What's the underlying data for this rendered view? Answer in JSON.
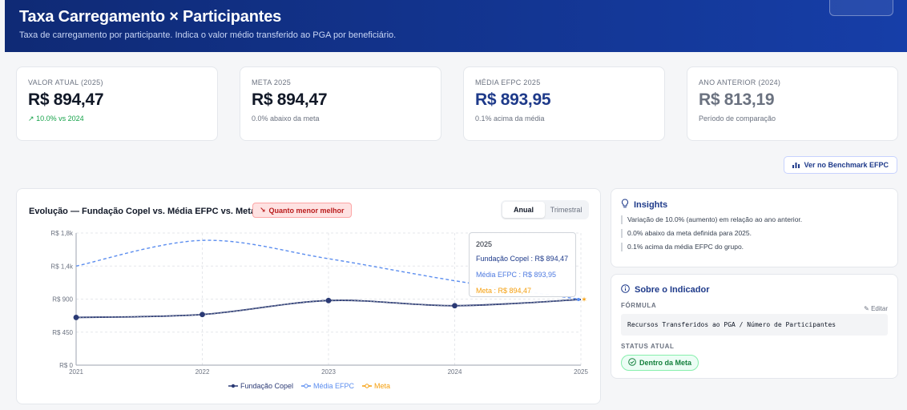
{
  "header": {
    "title": "Taxa Carregamento × Participantes",
    "subtitle": "Taxa de carregamento por participante. Indica o valor médio transferido ao PGA por beneficiário."
  },
  "kpis": [
    {
      "label": "VALOR ATUAL (2025)",
      "value": "R$ 894,47",
      "sub": "10.0% vs 2024",
      "sub_icon": "trend-up-icon",
      "value_color": "#111827"
    },
    {
      "label": "META 2025",
      "value": "R$ 894,47",
      "sub": "0.0% abaixo da meta",
      "value_color": "#111827"
    },
    {
      "label": "MÉDIA EFPC 2025",
      "value": "R$ 893,95",
      "sub": "0.1% acima da média",
      "value_color": "#1e3a8a"
    },
    {
      "label": "ANO ANTERIOR (2024)",
      "value": "R$ 813,19",
      "sub": "Período de comparação",
      "value_color": "#6b7280"
    }
  ],
  "benchmark_button": {
    "label": "Ver no Benchmark EFPC",
    "icon": "bar-chart-icon"
  },
  "chart_panel": {
    "title": "Evolução — Fundação Copel vs. Média EFPC vs. Meta",
    "badge": "Quanto menor melhor",
    "badge_icon": "trend-down-icon",
    "toggle": [
      "Anual",
      "Trimestral"
    ],
    "toggle_selected": "Anual"
  },
  "chart_data": {
    "type": "line",
    "x": [
      "2021",
      "2022",
      "2023",
      "2024",
      "2025"
    ],
    "y_ticks": [
      "R$ 0",
      "R$ 450",
      "R$ 900",
      "R$ 1,4k",
      "R$ 1,8k"
    ],
    "ylim": [
      0,
      1800
    ],
    "series": [
      {
        "name": "Fundação Copel",
        "color": "#2b3a75",
        "values": [
          650,
          690,
          880,
          810,
          894.47
        ]
      },
      {
        "name": "Média EFPC",
        "color": "#5b8def",
        "values": [
          1350,
          1700,
          1450,
          1150,
          893.95
        ]
      },
      {
        "name": "Meta",
        "color": "#f59e0b",
        "values": [
          null,
          null,
          null,
          null,
          894.47
        ]
      }
    ],
    "tooltip": {
      "x": "2025",
      "lines": [
        "Fundação Copel : R$ 894,47",
        "Média EFPC : R$ 893,95",
        "Meta : R$ 894,47"
      ]
    },
    "legend_position": "bottom-center",
    "grid": true
  },
  "insights": {
    "title": "Insights",
    "icon": "lightbulb-icon",
    "items": [
      "Variação de 10.0% (aumento) em relação ao ano anterior.",
      "0.0% abaixo da meta definida para 2025.",
      "0.1% acima da média EFPC do grupo."
    ]
  },
  "about": {
    "title": "Sobre o Indicador",
    "icon": "info-icon",
    "formula_label": "FÓRMULA",
    "edit_label": "Editar",
    "formula": "Recursos Transferidos ao PGA / Número de Participantes",
    "status_label": "STATUS ATUAL",
    "status": "Dentro da Meta",
    "status_icon": "check-circle-icon"
  }
}
